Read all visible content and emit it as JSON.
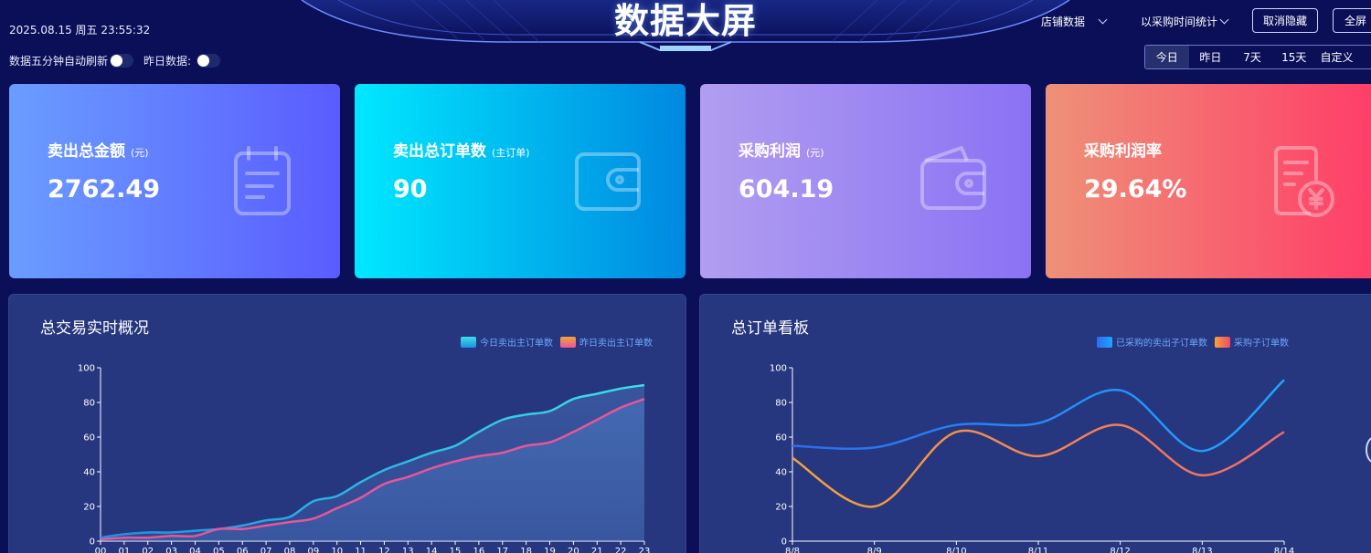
{
  "header": {
    "title": "数据大屏",
    "datetime": "2025.08.15 周五 23:55:32",
    "auto_refresh_label": "数据五分钟自动刷新",
    "yesterday_label": "昨日数据:",
    "shop_dropdown": "店铺数据",
    "stat_dropdown": "以采购时间统计",
    "hide_button": "取消隐藏",
    "fullscreen_button": "全屏"
  },
  "range_tabs": [
    "今日",
    "昨日",
    "7天",
    "15天",
    "自定义"
  ],
  "range_active": "今日",
  "cards": [
    {
      "title": "卖出总金额",
      "unit": "(元)",
      "value": "2762.49",
      "icon": "clipboard-icon",
      "gradient": [
        "#6a9dff",
        "#5a5cff"
      ]
    },
    {
      "title": "卖出总订单数",
      "unit": "(主订单)",
      "value": "90",
      "icon": "wallet-icon",
      "gradient": [
        "#00e8ff",
        "#0088e0"
      ]
    },
    {
      "title": "采购利润",
      "unit": "(元)",
      "value": "604.19",
      "icon": "purse-icon",
      "gradient": [
        "#b19ef0",
        "#8a72f4"
      ]
    },
    {
      "title": "采购利润率",
      "unit": "",
      "value": "29.64%",
      "icon": "receipt-yen-icon",
      "gradient": [
        "#ee9178",
        "#ff3d68"
      ]
    }
  ],
  "panel_left": {
    "title": "总交易实时概况",
    "legend": [
      "今日卖出主订单数",
      "昨日卖出主订单数"
    ]
  },
  "panel_right": {
    "title": "总订单看板",
    "legend": [
      "已采购的卖出子订单数",
      "采购子订单数"
    ]
  },
  "chart_data": [
    {
      "type": "area",
      "title": "总交易实时概况",
      "categories": [
        "00",
        "01",
        "02",
        "03",
        "04",
        "05",
        "06",
        "07",
        "08",
        "09",
        "10",
        "11",
        "12",
        "13",
        "14",
        "15",
        "16",
        "17",
        "18",
        "19",
        "20",
        "21",
        "22",
        "23"
      ],
      "ylim": [
        0,
        100
      ],
      "yticks": [
        0,
        20,
        40,
        60,
        80,
        100
      ],
      "grid": false,
      "legend_position": "top-right",
      "series": [
        {
          "name": "今日卖出主订单数",
          "color": "#3be0e8",
          "values": [
            2,
            4,
            5,
            5,
            6,
            7,
            9,
            12,
            14,
            23,
            26,
            34,
            41,
            46,
            51,
            55,
            63,
            70,
            73,
            75,
            82,
            85,
            88,
            90
          ]
        },
        {
          "name": "昨日卖出主订单数",
          "color": "#e8559a",
          "values": [
            1,
            2,
            2,
            3,
            3,
            7,
            7,
            9,
            11,
            13,
            19,
            25,
            33,
            37,
            42,
            46,
            49,
            51,
            55,
            57,
            63,
            70,
            77,
            82
          ]
        }
      ]
    },
    {
      "type": "line",
      "title": "总订单看板",
      "categories": [
        "8/8",
        "8/9",
        "8/10",
        "8/11",
        "8/12",
        "8/13",
        "8/14"
      ],
      "ylim": [
        0,
        100
      ],
      "yticks": [
        0,
        20,
        40,
        60,
        80,
        100
      ],
      "grid": false,
      "legend_position": "top-right",
      "series": [
        {
          "name": "已采购的卖出子订单数",
          "color": "#1ea6ff",
          "values": [
            55,
            54,
            67,
            68,
            87,
            52,
            93
          ]
        },
        {
          "name": "采购子订单数",
          "color": "#f06a6a",
          "values": [
            48,
            20,
            63,
            49,
            67,
            38,
            63
          ]
        }
      ]
    }
  ]
}
